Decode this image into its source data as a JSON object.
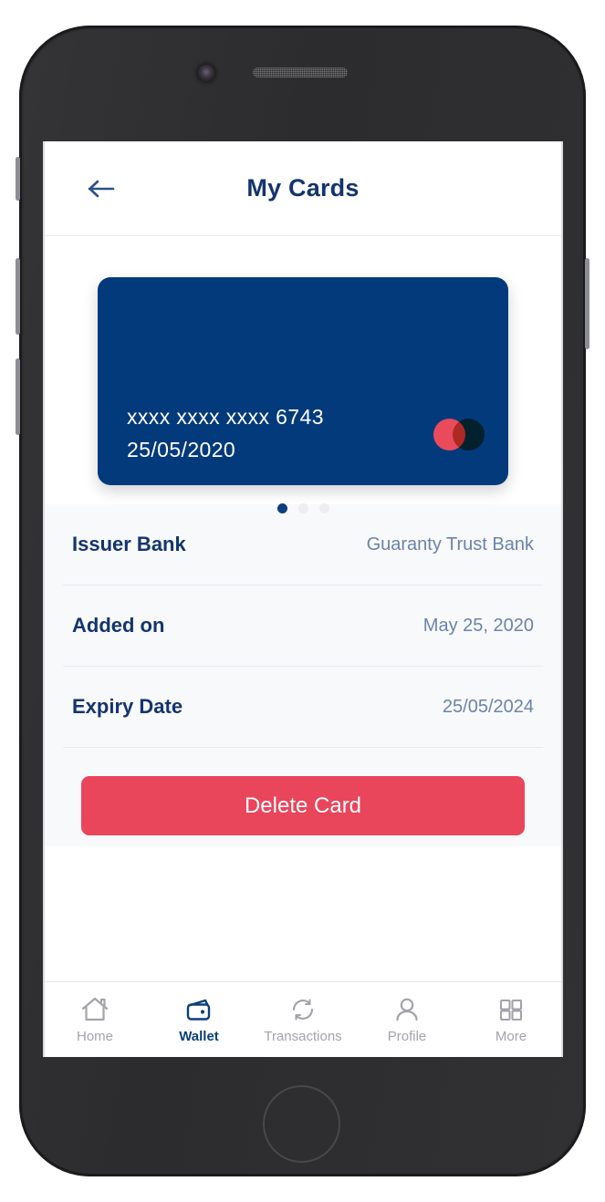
{
  "header": {
    "title": "My Cards",
    "back_icon": "arrow-left-icon"
  },
  "card": {
    "number": "xxxx xxxx xxxx 6743",
    "date": "25/05/2020",
    "brand": "mastercard-logo",
    "background_color": "#033a7b",
    "carousel": {
      "total": 3,
      "active_index": 0
    }
  },
  "details": [
    {
      "label": "Issuer Bank",
      "value": "Guaranty Trust Bank"
    },
    {
      "label": "Added on",
      "value": "May 25, 2020"
    },
    {
      "label": "Expiry Date",
      "value": "25/05/2024"
    }
  ],
  "actions": {
    "delete_label": "Delete Card",
    "delete_color": "#e9455b"
  },
  "bottom_nav": {
    "active": "Wallet",
    "items": [
      {
        "label": "Home",
        "icon": "home-icon"
      },
      {
        "label": "Wallet",
        "icon": "wallet-icon"
      },
      {
        "label": "Transactions",
        "icon": "refresh-icon"
      },
      {
        "label": "Profile",
        "icon": "person-icon"
      },
      {
        "label": "More",
        "icon": "grid-icon"
      }
    ]
  },
  "theme": {
    "navy": "#13346e",
    "muted_blue": "#6b83ab",
    "accent_red": "#e9455b"
  }
}
